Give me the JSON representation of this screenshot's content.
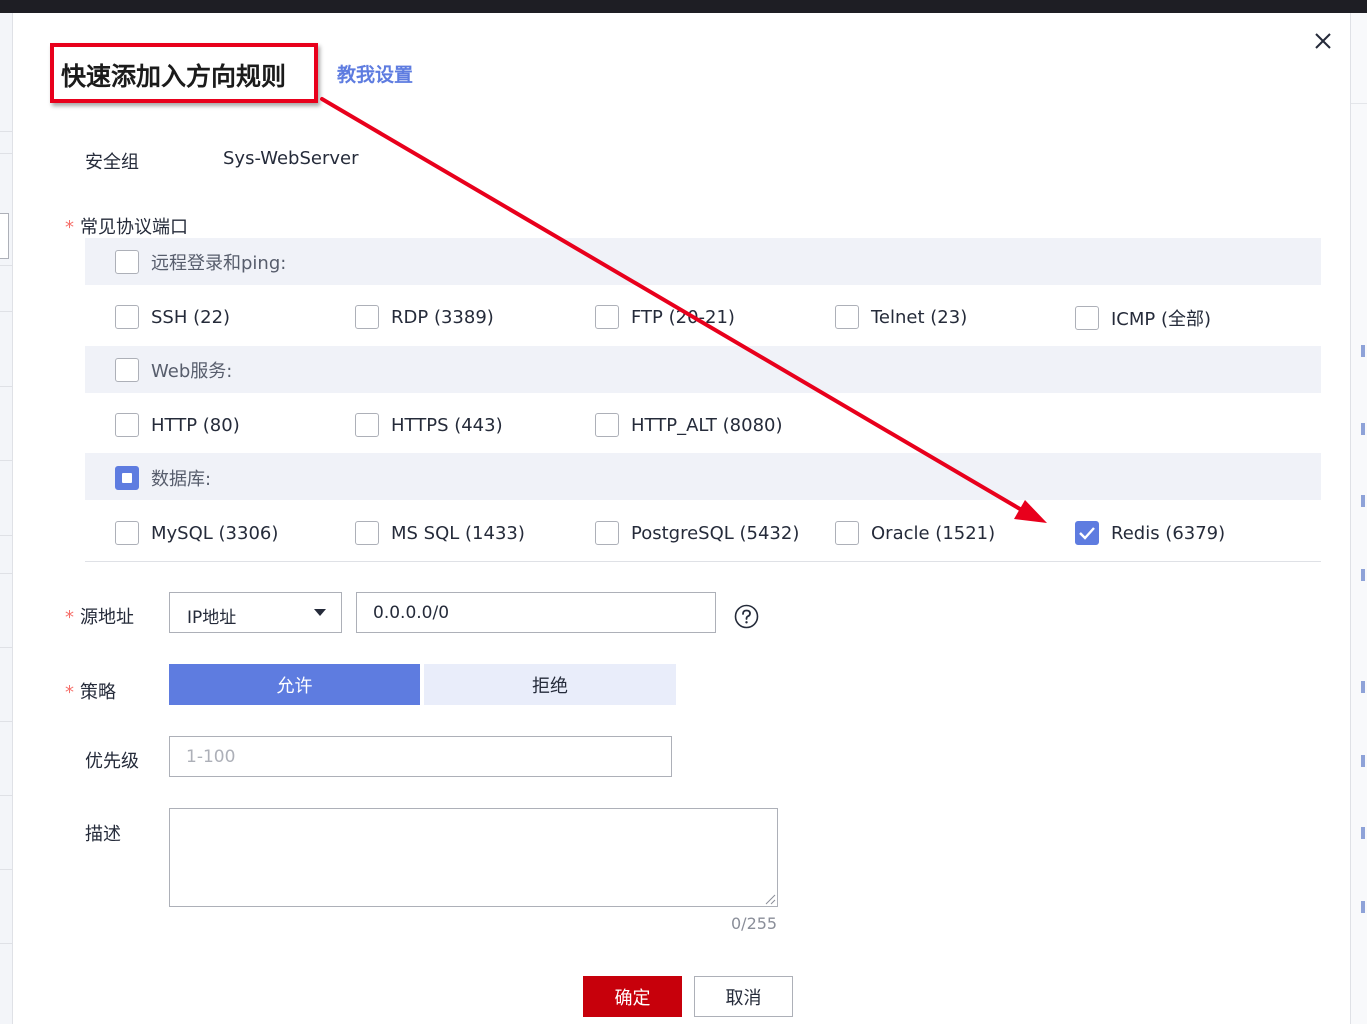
{
  "dialog": {
    "title": "快速添加入方向规则",
    "guide_link": "教我设置",
    "close_icon": "close-icon"
  },
  "security_group": {
    "label": "安全组",
    "value": "Sys-WebServer"
  },
  "ports": {
    "label": "常见协议端口",
    "required_mark": "*",
    "groups": [
      {
        "name": "远程登录和ping:",
        "state": "unchecked",
        "items": [
          {
            "label": "SSH (22)",
            "checked": false
          },
          {
            "label": "RDP (3389)",
            "checked": false
          },
          {
            "label": "FTP (20-21)",
            "checked": false
          },
          {
            "label": "Telnet (23)",
            "checked": false
          },
          {
            "label": "ICMP (全部)",
            "checked": false
          }
        ]
      },
      {
        "name": "Web服务:",
        "state": "unchecked",
        "items": [
          {
            "label": "HTTP (80)",
            "checked": false
          },
          {
            "label": "HTTPS (443)",
            "checked": false
          },
          {
            "label": "HTTP_ALT (8080)",
            "checked": false
          }
        ]
      },
      {
        "name": "数据库:",
        "state": "partial",
        "items": [
          {
            "label": "MySQL (3306)",
            "checked": false
          },
          {
            "label": "MS SQL (1433)",
            "checked": false
          },
          {
            "label": "PostgreSQL (5432)",
            "checked": false
          },
          {
            "label": "Oracle (1521)",
            "checked": false
          },
          {
            "label": "Redis (6379)",
            "checked": true
          }
        ]
      }
    ]
  },
  "source": {
    "label": "源地址",
    "required_mark": "*",
    "type_value": "IP地址",
    "address_value": "0.0.0.0/0",
    "help_icon": "question-circle-icon"
  },
  "policy": {
    "label": "策略",
    "required_mark": "*",
    "allow": "允许",
    "deny": "拒绝",
    "selected": "allow"
  },
  "priority": {
    "label": "优先级",
    "placeholder": "1-100",
    "value": ""
  },
  "description": {
    "label": "描述",
    "value": "",
    "counter": "0/255"
  },
  "footer": {
    "confirm": "确定",
    "cancel": "取消"
  },
  "colors": {
    "accent": "#5e7ce0",
    "primary_button": "#c7000b",
    "annotation": "#e8001c",
    "required": "#f66f6a"
  }
}
